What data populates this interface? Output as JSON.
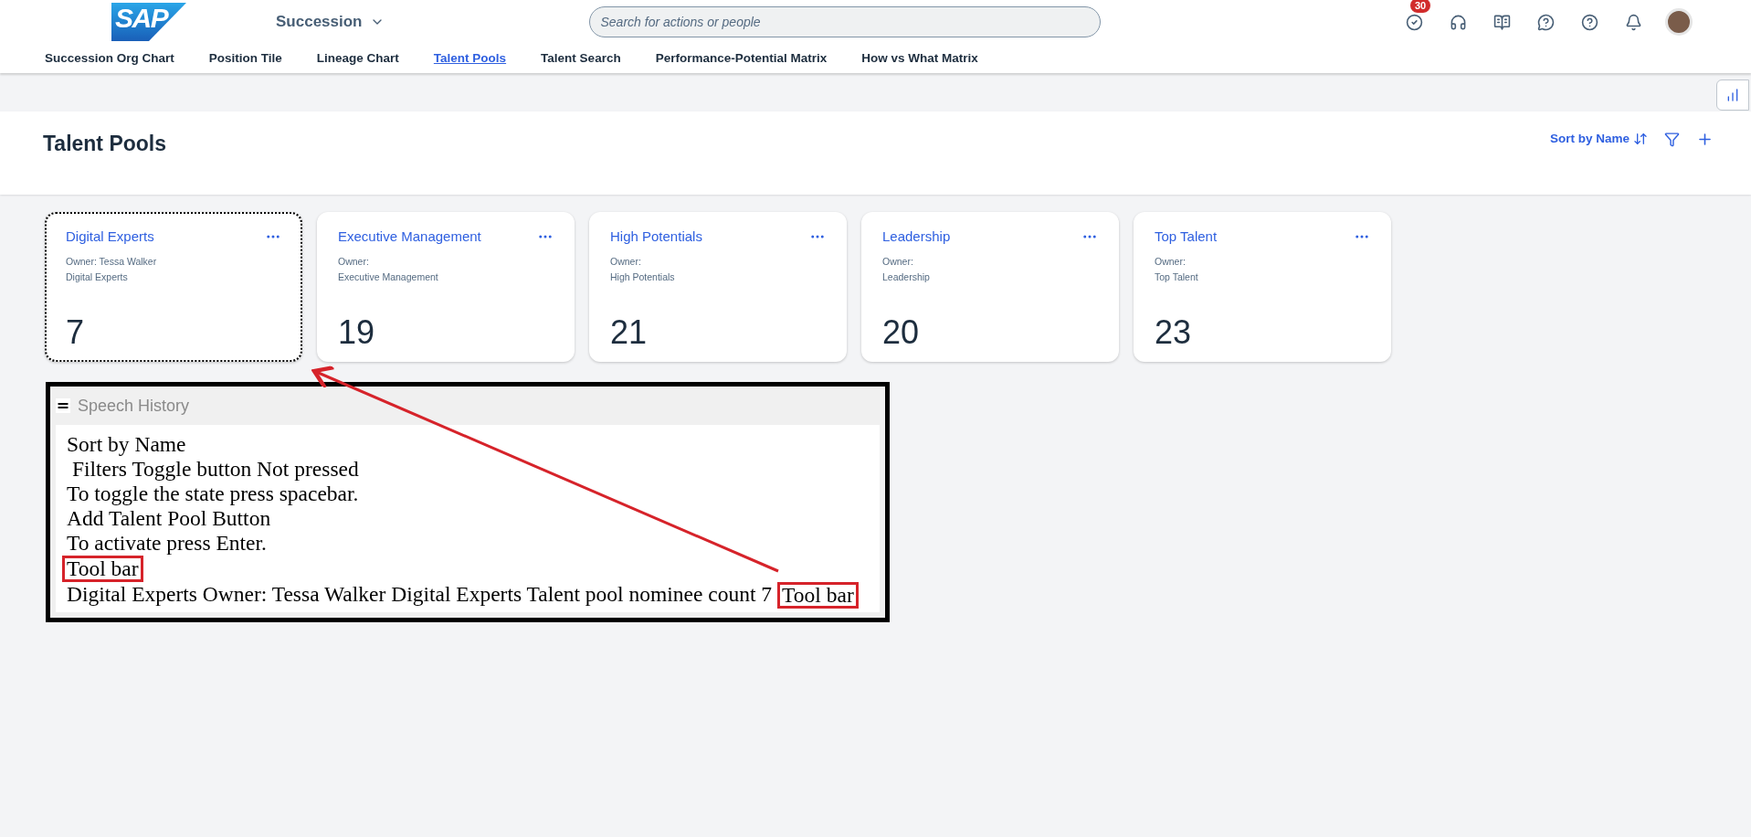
{
  "header": {
    "logo": "SAP",
    "app_menu": "Succession",
    "search": {
      "placeholder": "Search for actions or people"
    },
    "notification_count": "30"
  },
  "tabs": [
    {
      "label": "Succession Org Chart",
      "selected": false
    },
    {
      "label": "Position Tile",
      "selected": false
    },
    {
      "label": "Lineage Chart",
      "selected": false
    },
    {
      "label": "Talent Pools",
      "selected": true
    },
    {
      "label": "Talent Search",
      "selected": false
    },
    {
      "label": "Performance-Potential Matrix",
      "selected": false
    },
    {
      "label": "How vs What Matrix",
      "selected": false
    }
  ],
  "page": {
    "title": "Talent Pools",
    "sort_button": "Sort by Name"
  },
  "cards": [
    {
      "title": "Digital Experts",
      "owner": "Owner: Tessa Walker",
      "subtitle": "Digital Experts",
      "count": "7",
      "focused": true
    },
    {
      "title": "Executive Management",
      "owner": "Owner:",
      "subtitle": "Executive Management",
      "count": "19",
      "focused": false
    },
    {
      "title": "High Potentials",
      "owner": "Owner:",
      "subtitle": "High Potentials",
      "count": "21",
      "focused": false
    },
    {
      "title": "Leadership",
      "owner": "Owner:",
      "subtitle": "Leadership",
      "count": "20",
      "focused": false
    },
    {
      "title": "Top Talent",
      "owner": "Owner:",
      "subtitle": "Top Talent",
      "count": "23",
      "focused": false
    }
  ],
  "speech_history": {
    "title": "Speech History",
    "lines": [
      [
        {
          "text": "Sort by Name",
          "highlighted": false
        }
      ],
      [
        {
          "text": " Filters Toggle button Not pressed",
          "highlighted": false
        }
      ],
      [
        {
          "text": "To toggle the state press spacebar.",
          "highlighted": false
        }
      ],
      [
        {
          "text": "Add Talent Pool Button",
          "highlighted": false
        }
      ],
      [
        {
          "text": "To activate press Enter.",
          "highlighted": false
        }
      ],
      [
        {
          "text": "Tool bar",
          "highlighted": true
        }
      ],
      [
        {
          "text": "Digital Experts Owner: Tessa Walker Digital Experts Talent pool nominee count 7",
          "highlighted": false
        },
        {
          "text": "Tool bar",
          "highlighted": true
        }
      ]
    ]
  }
}
